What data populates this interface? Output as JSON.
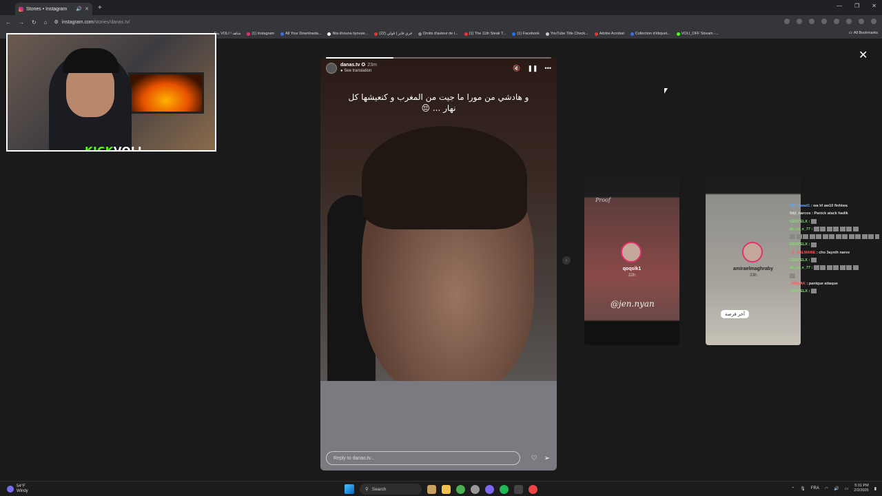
{
  "browser": {
    "tab_title": "Stories • Instagram",
    "url_host": "instagram.com",
    "url_path": "/stories/danas.tv/",
    "bookmarks": [
      "يحكي VOLI ! شاهد",
      "(1) Instagram",
      "All Your Downloada...",
      "Nta khouna tiyouse...",
      "(22) فري فاير | قولي",
      "Droits d'auteur de l...",
      "(1) The 11th Steak T...",
      "(1) Facebook",
      "YouTube Title Check...",
      "Adobe Acrobat",
      "Collection d'étiquet...",
      "VOLI_OFF Stream -..."
    ],
    "all_bookmarks": "All Bookmarks"
  },
  "webcam": {
    "logo_part1": "KICK",
    "logo_part2": "VOLI"
  },
  "story": {
    "username": "danas.tv",
    "time": "23m",
    "see_translation": "See translation",
    "caption": "و هادشي من مورا ما جيت من المغرب و كنعيشها كل نهار ... 😔",
    "reply_placeholder": "Reply to danas.tv...",
    "progress": 0.3
  },
  "previews": [
    {
      "name": "qoqsik1",
      "time": "22h",
      "overlay": "@jen.nyan",
      "top_text": "Proof"
    },
    {
      "name": "amiraelmaghraby",
      "time": "23h",
      "chip": "آخر فرصة"
    }
  ],
  "chat": [
    {
      "user": "VO_jawad1",
      "color": "#5ea8ff",
      "text": "wa lrl aw10 finhiwa",
      "emotes": 0
    },
    {
      "user": "0dji_narcos",
      "color": "#dddddd",
      "text": "Panick atack hadik",
      "emotes": 0
    },
    {
      "user": "GENTELX",
      "color": "#7ee06a",
      "text": "",
      "emotes": 1
    },
    {
      "user": "do_ni_x_77",
      "color": "#7ee06a",
      "text": "",
      "emotes": 7
    },
    {
      "user": "",
      "color": "#7ee06a",
      "text": "",
      "emotes": 15
    },
    {
      "user": "GENTELX",
      "color": "#7ee06a",
      "text": "",
      "emotes": 1
    },
    {
      "user": "_A_SALMANE",
      "color": "#ff5a5a",
      "text": "cho 3aynih naree",
      "emotes": 0
    },
    {
      "user": "GENTELX",
      "color": "#7ee06a",
      "text": "",
      "emotes": 1
    },
    {
      "user": "do_ni_x_77",
      "color": "#7ee06a",
      "text": "",
      "emotes": 7
    },
    {
      "user": "",
      "color": "#7ee06a",
      "text": "",
      "emotes": 1
    },
    {
      "user": "_MALAK",
      "color": "#ff5a5a",
      "text": "panique attaque",
      "emotes": 0
    },
    {
      "user": "GENTELX",
      "color": "#7ee06a",
      "text": "",
      "emotes": 1
    }
  ],
  "taskbar": {
    "temp": "54°F",
    "weather": "Windy",
    "search": "Search",
    "lang": "FRA",
    "time": "5:31 PM",
    "date": "2/2/2026"
  }
}
